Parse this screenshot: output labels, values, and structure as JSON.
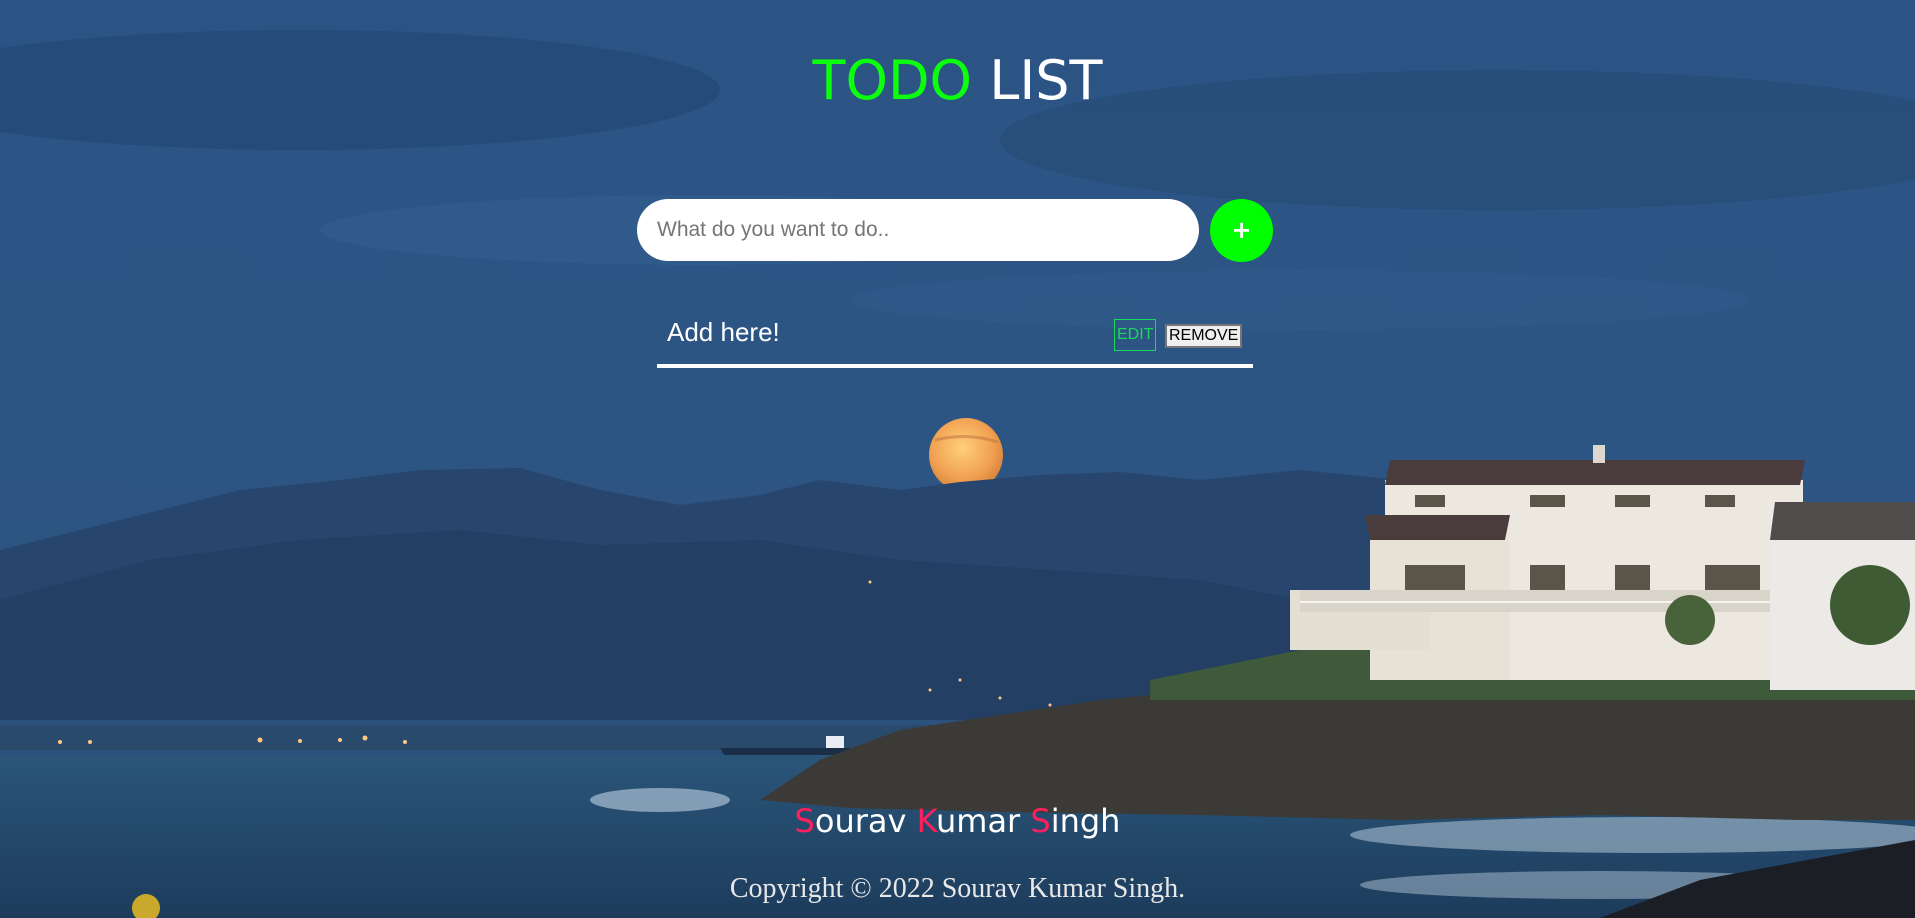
{
  "header": {
    "title_accent": "TODO",
    "title_rest": "LIST",
    "accent_color": "#00ff00"
  },
  "add_form": {
    "input_placeholder": "What do you want to do..",
    "input_value": "",
    "add_button_label": "+"
  },
  "todos": [
    {
      "text": "Add here!",
      "edit_label": "EDIT",
      "remove_label": "REMOVE"
    }
  ],
  "footer": {
    "author_parts": [
      {
        "initial": "S",
        "rest": "ourav"
      },
      {
        "initial": "K",
        "rest": "umar"
      },
      {
        "initial": "S",
        "rest": "ingh"
      }
    ],
    "author_initial_color": "#ff1f5a",
    "copyright": "Copyright © 2022 Sourav Kumar Singh."
  },
  "background": {
    "icon": "beach-moon-landscape-image"
  }
}
